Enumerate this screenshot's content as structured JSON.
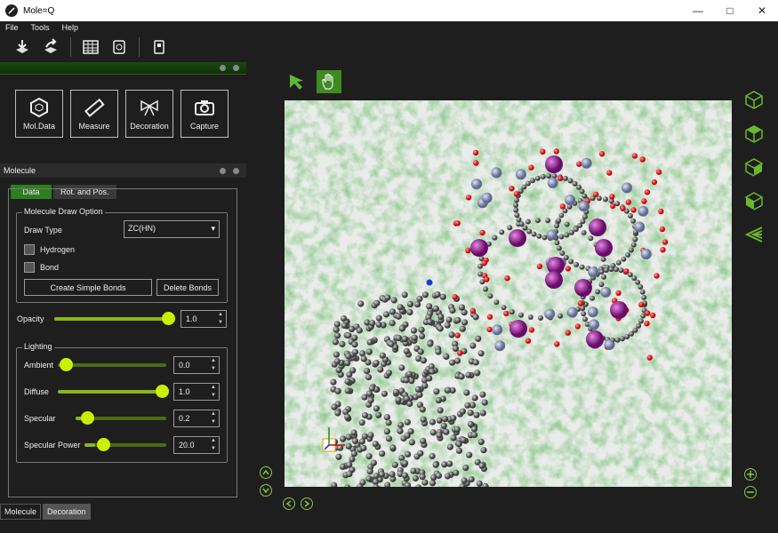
{
  "window": {
    "title": "Mole=Q"
  },
  "menu": [
    "File",
    "Tools",
    "Help"
  ],
  "tools": [
    {
      "label": "Mol.Data",
      "icon": "hexagon-icon"
    },
    {
      "label": "Measure",
      "icon": "ruler-icon"
    },
    {
      "label": "Decoration",
      "icon": "bow-icon"
    },
    {
      "label": "Capture",
      "icon": "camera-icon"
    }
  ],
  "molecule_panel": {
    "title": "Molecule",
    "tabs": [
      "Data",
      "Rot. and Pos."
    ],
    "draw_option_title": "Molecule Draw Option",
    "draw_type_label": "Draw Type",
    "draw_type_value": "ZC(HN)",
    "hydrogen_label": "Hydrogen",
    "bond_label": "Bond",
    "create_bonds": "Create Simple Bonds",
    "delete_bonds": "Delete Bonds",
    "opacity_label": "Opacity",
    "opacity_value": "1.0",
    "lighting_title": "Lighting",
    "ambient_label": "Ambient",
    "ambient_value": "0.0",
    "diffuse_label": "Diffuse",
    "diffuse_value": "1.0",
    "specular_label": "Specular",
    "specular_value": "0.2",
    "specpower_label": "Specular Power",
    "specpower_value": "20.0"
  },
  "bottom_tabs": [
    "Molecule",
    "Decoration"
  ],
  "colors": {
    "accent": "#2e7d1f",
    "knob": "#c9f000"
  }
}
